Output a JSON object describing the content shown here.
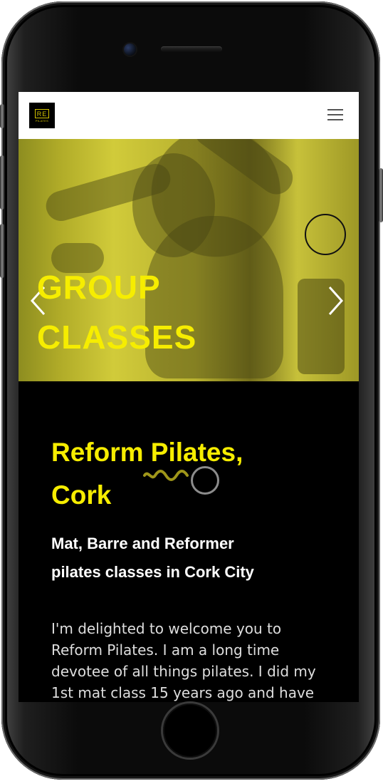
{
  "site": {
    "logo_text": "RE",
    "logo_subtext": "PILATES"
  },
  "hero": {
    "title_line_1": "GROUP",
    "title_line_2": "CLASSES"
  },
  "intro": {
    "headline_line_1": "Reform Pilates,",
    "headline_line_2": "Cork",
    "subheading_line_1": "Mat, Barre and Reformer",
    "subheading_line_2": "pilates classes in Cork City",
    "body_line_1": "I'm delighted to welcome you to",
    "body_line_2": "Reform Pilates. I am a long time",
    "body_line_3": "devotee of all things pilates. I did my",
    "body_line_4": "1st mat class 15 years ago and have"
  },
  "icons": {
    "menu": "hamburger-menu-icon",
    "left_arrow": "chevron-left-icon",
    "right_arrow": "chevron-right-icon"
  },
  "colors": {
    "accent": "#f6ed00",
    "background": "#000000",
    "navbar": "#ffffff"
  }
}
